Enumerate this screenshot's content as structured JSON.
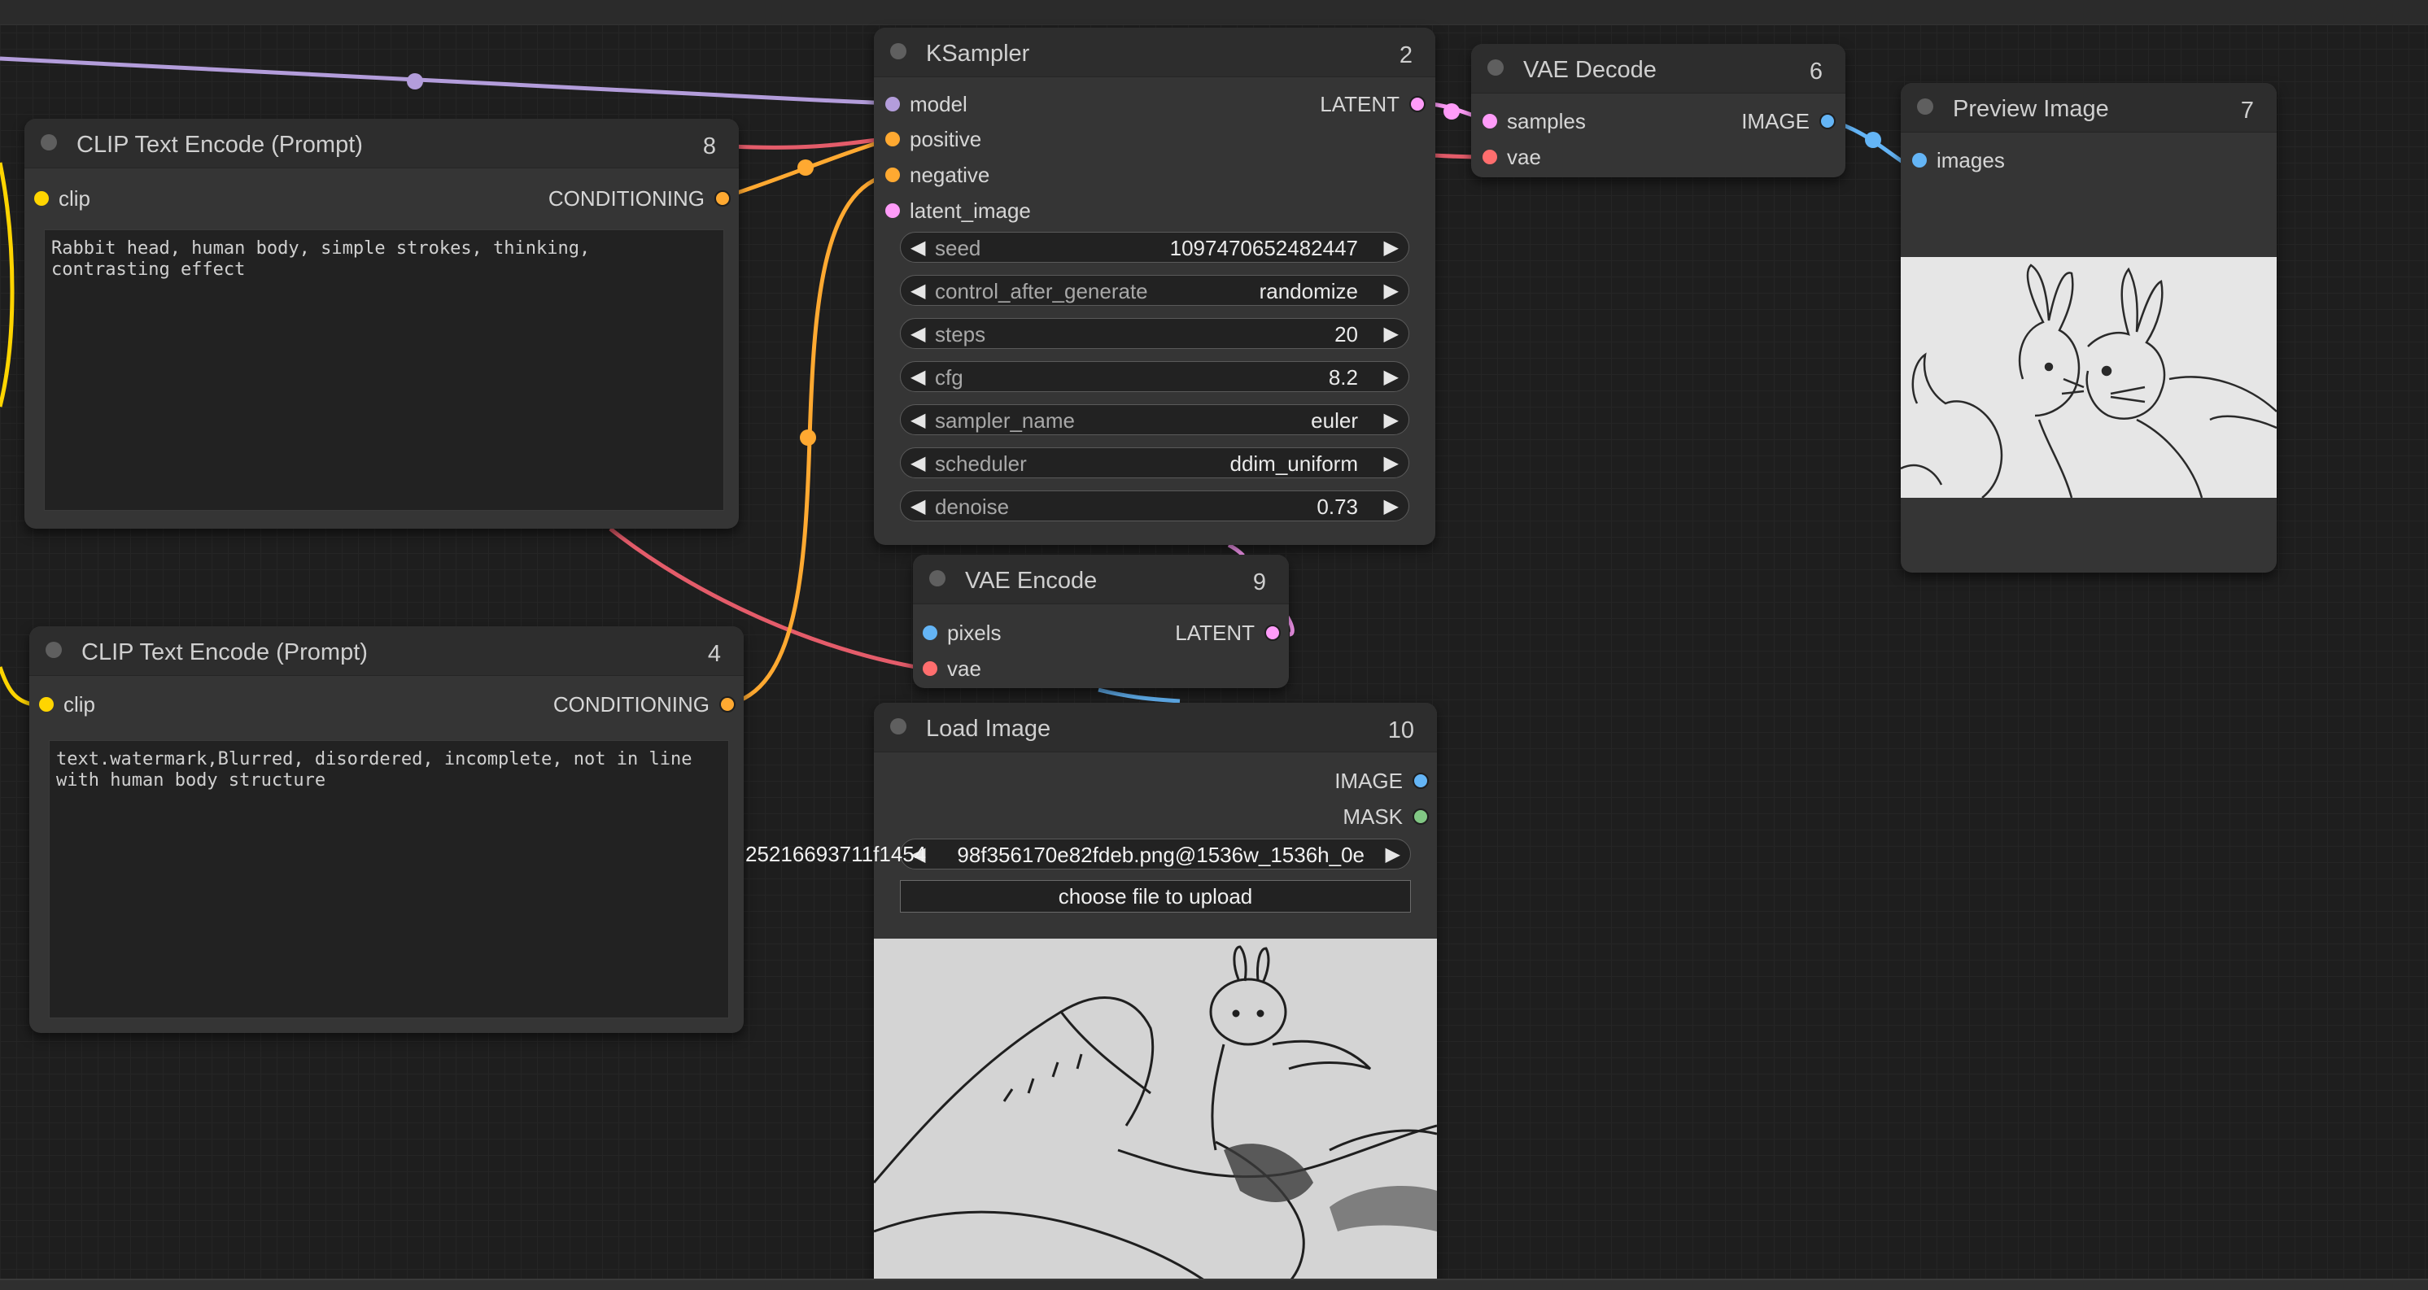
{
  "colors": {
    "model": "#b39ddb",
    "conditioning": "#ffa931",
    "clip": "#ffd500",
    "latent": "#ff9cf9",
    "vae": "#ff6e6e",
    "image": "#64b5f6",
    "mask": "#81c784",
    "clip_wire": "#ffd500",
    "vae_wire": "#e45c6a"
  },
  "nodes": {
    "ksampler": {
      "title": "KSampler",
      "id": "2",
      "inputs": [
        "model",
        "positive",
        "negative",
        "latent_image"
      ],
      "output": "LATENT",
      "widgets": [
        {
          "label": "seed",
          "value": "1097470652482447"
        },
        {
          "label": "control_after_generate",
          "value": "randomize"
        },
        {
          "label": "steps",
          "value": "20"
        },
        {
          "label": "cfg",
          "value": "8.2"
        },
        {
          "label": "sampler_name",
          "value": "euler"
        },
        {
          "label": "scheduler",
          "value": "ddim_uniform"
        },
        {
          "label": "denoise",
          "value": "0.73"
        }
      ]
    },
    "vae_decode": {
      "title": "VAE Decode",
      "id": "6",
      "inputs": [
        "samples",
        "vae"
      ],
      "output": "IMAGE"
    },
    "preview_image": {
      "title": "Preview Image",
      "id": "7",
      "inputs": [
        "images"
      ]
    },
    "clip_pos": {
      "title": "CLIP Text Encode (Prompt)",
      "id": "8",
      "input": "clip",
      "output": "CONDITIONING",
      "text": "Rabbit head, human body, simple strokes, thinking, contrasting effect"
    },
    "clip_neg": {
      "title": "CLIP Text Encode (Prompt)",
      "id": "4",
      "input": "clip",
      "output": "CONDITIONING",
      "text": "text.watermark,Blurred, disordered, incomplete, not in line with human body structure"
    },
    "vae_encode": {
      "title": "VAE Encode",
      "id": "9",
      "inputs": [
        "pixels",
        "vae"
      ],
      "output": "LATENT"
    },
    "load_image": {
      "title": "Load Image",
      "id": "10",
      "outputs": [
        "IMAGE",
        "MASK"
      ],
      "image_value": "98f356170e82fdeb.png@1536w_1536h_0e",
      "image_overflow": "25216693711f1454",
      "upload_label": "choose file to upload"
    }
  },
  "icons": {
    "arrow_left": "◀",
    "arrow_right": "▶"
  }
}
